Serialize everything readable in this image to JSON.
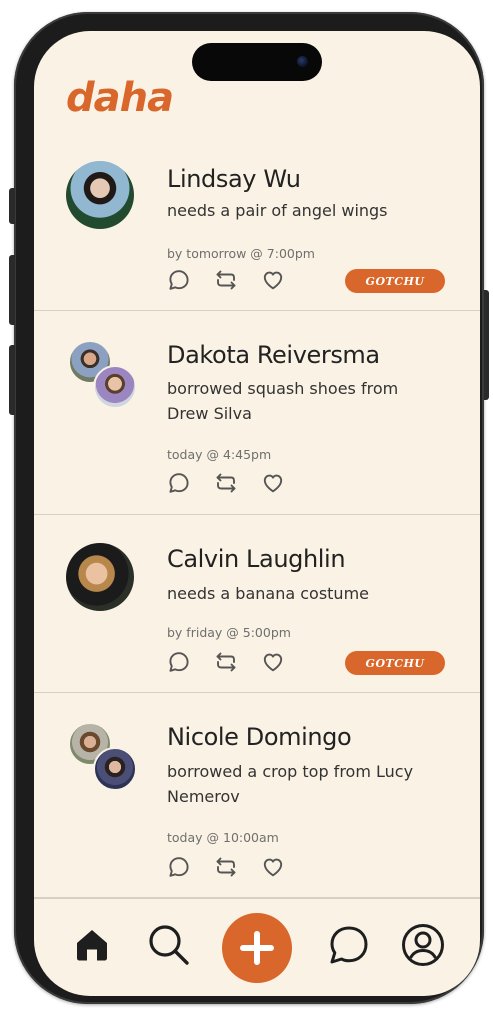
{
  "app": {
    "logo": "daha",
    "accent_color": "#d9662a",
    "background_color": "#faf3e5"
  },
  "feed": {
    "posts": [
      {
        "name": "Lindsay Wu",
        "text": "needs a pair of angel wings",
        "time": "by tomorrow @ 7:00pm",
        "avatars": [
          "profile-photo"
        ],
        "action_label": "GOTCHU",
        "actions": [
          "comment-icon",
          "repost-icon",
          "heart-icon"
        ]
      },
      {
        "name": "Dakota Reiversma",
        "text": "borrowed squash shoes from Drew Silva",
        "time": "today @ 4:45pm",
        "avatars": [
          "profile-photo",
          "profile-photo"
        ],
        "actions": [
          "comment-icon",
          "repost-icon",
          "heart-icon"
        ]
      },
      {
        "name": "Calvin Laughlin",
        "text": "needs a banana costume",
        "time": "by friday @ 5:00pm",
        "avatars": [
          "profile-photo"
        ],
        "action_label": "GOTCHU",
        "actions": [
          "comment-icon",
          "repost-icon",
          "heart-icon"
        ]
      },
      {
        "name": "Nicole Domingo",
        "text": "borrowed a crop top from Lucy Nemerov",
        "time": "today @ 10:00am",
        "avatars": [
          "profile-photo",
          "profile-photo"
        ],
        "actions": [
          "comment-icon",
          "repost-icon",
          "heart-icon"
        ]
      }
    ]
  },
  "tabbar": {
    "items": [
      {
        "icon": "home-icon",
        "active": true
      },
      {
        "icon": "search-icon"
      },
      {
        "icon": "plus-icon"
      },
      {
        "icon": "chat-icon"
      },
      {
        "icon": "profile-icon"
      }
    ]
  }
}
